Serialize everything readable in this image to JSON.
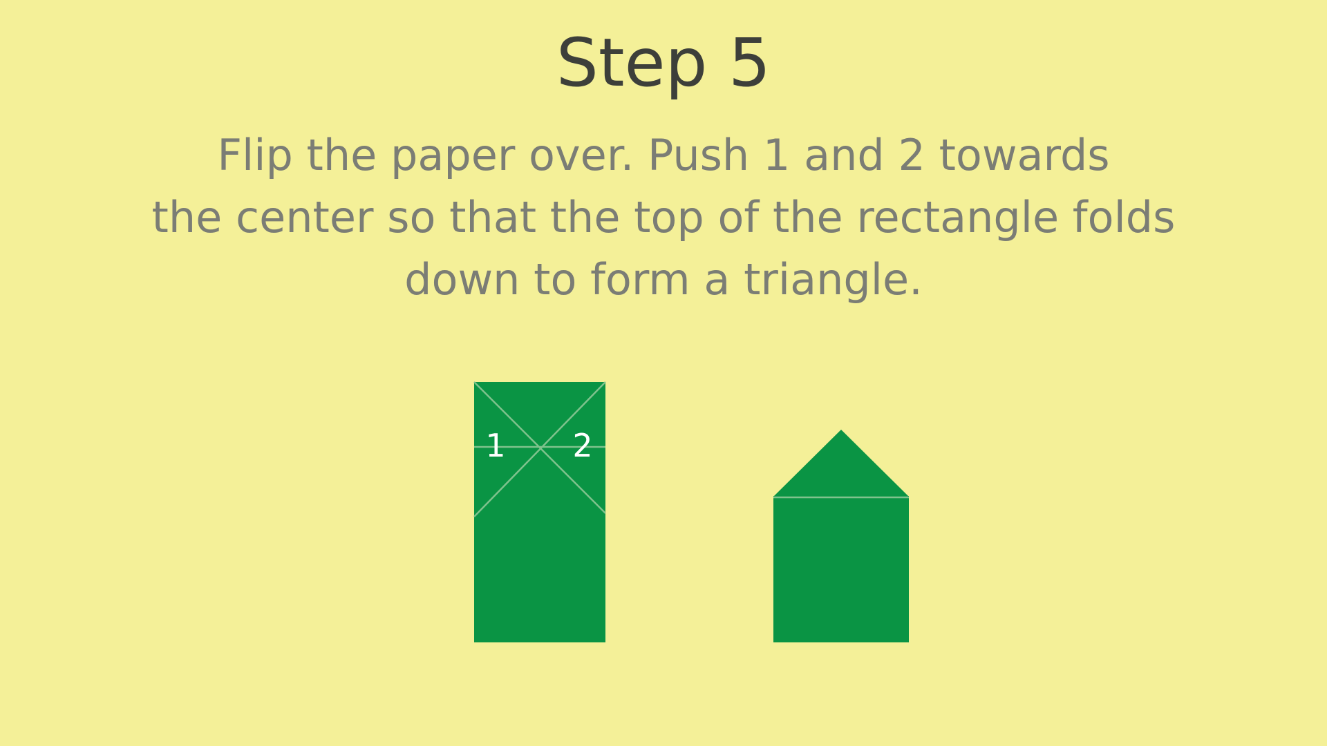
{
  "slide": {
    "title": "Step 5",
    "instructions": [
      "Flip the paper over. Push 1 and 2 towards",
      "the center so that the top of the rectangle folds",
      "down to form a triangle."
    ]
  },
  "diagram": {
    "labels": {
      "point_1": "1",
      "point_2": "2"
    },
    "colors": {
      "background": "#f4f098",
      "paper": "#0a9444",
      "crease": "#7fc28d",
      "label": "#ffffff",
      "title_text": "#3d3f3a",
      "body_text": "#7b7d75"
    }
  }
}
